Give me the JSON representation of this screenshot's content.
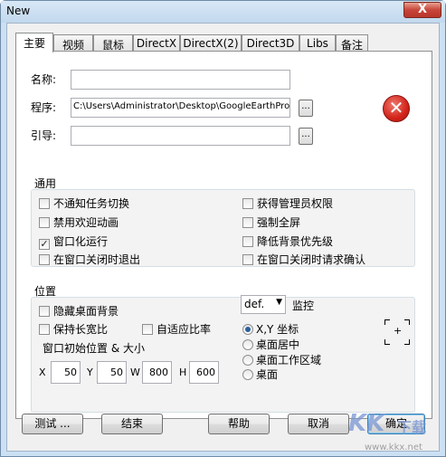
{
  "window": {
    "title": "New",
    "close_glyph": "X"
  },
  "tabs": [
    "主要",
    "视频",
    "鼠标",
    "DirectX",
    "DirectX(2)",
    "Direct3D",
    "Libs",
    "备注"
  ],
  "fields": {
    "name_label": "名称:",
    "name_value": "",
    "program_label": "程序:",
    "program_value": "C:\\Users\\Administrator\\Desktop\\GoogleEarthProF",
    "arg_label": "引导:",
    "arg_value": "",
    "browse_label": "...",
    "error_icon": "error-x-icon",
    "error_glyph": "✕"
  },
  "general": {
    "title": "通用",
    "left": [
      {
        "label": "不通知任务切换",
        "checked": false
      },
      {
        "label": "禁用欢迎动画",
        "checked": false
      },
      {
        "label": "窗口化运行",
        "checked": true
      },
      {
        "label": "在窗口关闭时退出",
        "checked": false
      }
    ],
    "right": [
      {
        "label": "获得管理员权限",
        "checked": false
      },
      {
        "label": "强制全屏",
        "checked": false
      },
      {
        "label": "降低背景优先级",
        "checked": false
      },
      {
        "label": "在窗口关闭时请求确认",
        "checked": false
      }
    ]
  },
  "position": {
    "title": "位置",
    "hide_desktop": "隐藏桌面背景",
    "keep_aspect": "保持长宽比",
    "adaptive_ratio": "自适应比率",
    "init_label": "窗口初始位置 & 大小",
    "monitor_select": "def.",
    "monitor_label": "监控",
    "x_label": "X",
    "x_value": "50",
    "y_label": "Y",
    "y_value": "50",
    "w_label": "W",
    "w_value": "800",
    "h_label": "H",
    "h_value": "600",
    "radios": [
      {
        "label": "X,Y 坐标",
        "selected": true
      },
      {
        "label": "桌面居中",
        "selected": false
      },
      {
        "label": "桌面工作区域",
        "selected": false
      },
      {
        "label": "桌面",
        "selected": false
      }
    ],
    "crosshair_plus": "+"
  },
  "buttons": {
    "test": "测试 ...",
    "end": "结束",
    "help": "帮助",
    "cancel": "取消",
    "ok": "确定"
  },
  "watermark": {
    "brand": "KK",
    "cn": "下载",
    "url": "www.kkx.net"
  },
  "colors": {
    "accent": "#3c7fb1",
    "error": "#d2231a"
  }
}
